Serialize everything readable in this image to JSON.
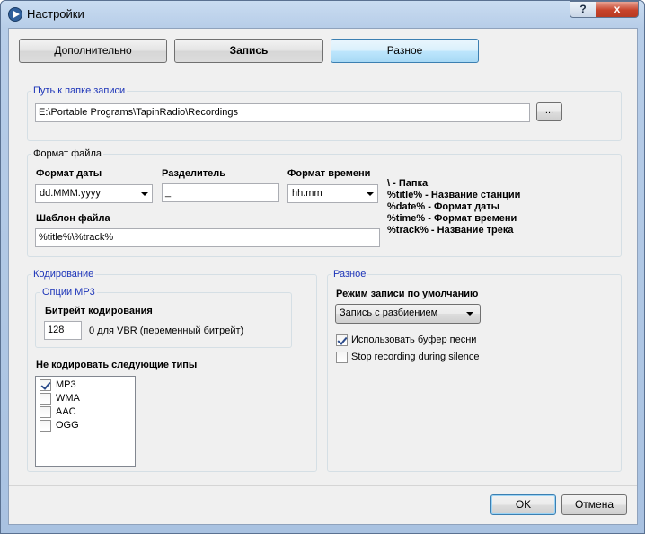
{
  "window": {
    "title": "Настройки"
  },
  "titlebar": {
    "help": "?",
    "close": "x"
  },
  "tabs": [
    {
      "label": "Дополнительно"
    },
    {
      "label": "Запись"
    },
    {
      "label": "Разное"
    }
  ],
  "record_path": {
    "group_title": "Путь к папке записи",
    "value": "E:\\Portable Programs\\TapinRadio\\Recordings",
    "browse_label": "..."
  },
  "file_format": {
    "group_title": "Формат файла",
    "date_format_label": "Формат даты",
    "date_format_value": "dd.MMM.yyyy",
    "separator_label": "Разделитель",
    "separator_value": "_",
    "time_format_label": "Формат времени",
    "time_format_value": "hh.mm",
    "template_label": "Шаблон файла",
    "template_value": "%title%\\%track%",
    "legend": [
      "\\ - Папка",
      "%title% - Название станции",
      "%date% - Формат даты",
      "%time% - Формат времени",
      "%track% - Название трека"
    ]
  },
  "encoding": {
    "group_title": "Кодирование",
    "mp3_options_title": "Опции MP3",
    "bitrate_label": "Битрейт кодирования",
    "bitrate_value": "128",
    "bitrate_hint": "0 для VBR (переменный битрейт)",
    "no_encode_label": "Не кодировать следующие типы",
    "types": [
      {
        "label": "MP3",
        "checked": true
      },
      {
        "label": "WMA",
        "checked": false
      },
      {
        "label": "AAC",
        "checked": false
      },
      {
        "label": "OGG",
        "checked": false
      }
    ]
  },
  "misc": {
    "group_title": "Разное",
    "mode_label": "Режим записи по умолчанию",
    "mode_value": "Запись с разбиением",
    "use_song_buffer_label": "Использовать буфер песни",
    "use_song_buffer_checked": true,
    "stop_on_silence_label": "Stop recording during silence",
    "stop_on_silence_checked": false
  },
  "buttons": {
    "ok": "OK",
    "cancel": "Отмена"
  },
  "colors": {
    "group_title_blue": "#1c34b8",
    "titlebar": "#b7cde8",
    "close_red": "#c7432a"
  }
}
